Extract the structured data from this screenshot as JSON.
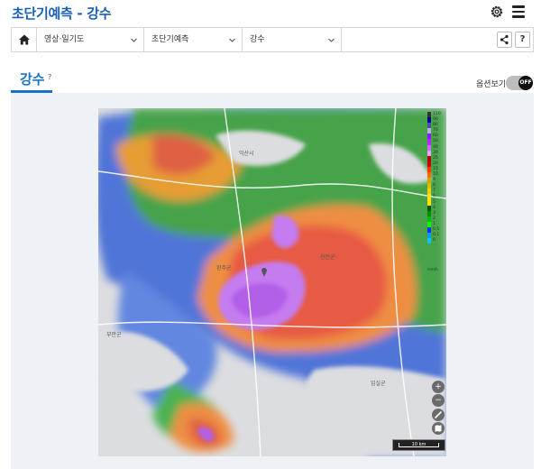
{
  "header": {
    "title": "초단기예측 - 강수",
    "settings_icon": "gear-icon",
    "menu_icon": "hamburger-menu-icon"
  },
  "breadcrumb": {
    "home_icon": "home-icon",
    "items": [
      {
        "label": "영상·일기도"
      },
      {
        "label": "초단기예측"
      },
      {
        "label": "강수"
      }
    ],
    "share_icon": "share-icon",
    "help_label": "?"
  },
  "tab": {
    "label": "강수",
    "help": "?"
  },
  "legend_toggle": {
    "label": "옵션보기",
    "state": "OFF"
  },
  "map": {
    "places": [
      "익산시",
      "완주군",
      "진안군",
      "부안군",
      "임실군"
    ],
    "zoom_in": "+",
    "zoom_out": "−",
    "scale_label": "10 km"
  },
  "legend": {
    "unit": "mm/h",
    "levels": [
      {
        "value": "110",
        "color": "#333333"
      },
      {
        "value": "90",
        "color": "#000390"
      },
      {
        "value": "80",
        "color": "#4c4eb1"
      },
      {
        "value": "70",
        "color": "#b3b4de"
      },
      {
        "value": "60",
        "color": "#9314ff"
      },
      {
        "value": "50",
        "color": "#b329ff"
      },
      {
        "value": "40",
        "color": "#c969ff"
      },
      {
        "value": "30",
        "color": "#e0a9ff"
      },
      {
        "value": "25",
        "color": "#b40000"
      },
      {
        "value": "20",
        "color": "#d20000"
      },
      {
        "value": "15",
        "color": "#ff3200"
      },
      {
        "value": "10",
        "color": "#ff6600"
      },
      {
        "value": "9",
        "color": "#ccaa00"
      },
      {
        "value": "8",
        "color": "#e0b900"
      },
      {
        "value": "7",
        "color": "#f9cd00"
      },
      {
        "value": "6",
        "color": "#ffdc1f"
      },
      {
        "value": "5",
        "color": "#ffe100"
      },
      {
        "value": "4",
        "color": "#005a00"
      },
      {
        "value": "3",
        "color": "#008c00"
      },
      {
        "value": "2",
        "color": "#00be00"
      },
      {
        "value": "1",
        "color": "#00ff00"
      },
      {
        "value": "0.5",
        "color": "#0033f5"
      },
      {
        "value": "0.1",
        "color": "#009bf5"
      },
      {
        "value": "0",
        "color": "#00c8ff"
      }
    ]
  }
}
